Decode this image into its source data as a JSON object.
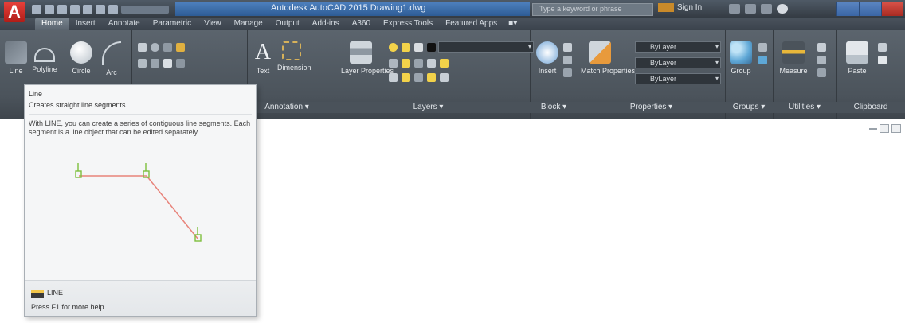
{
  "app": {
    "logo": "A",
    "title": "Autodesk AutoCAD 2015   Drawing1.dwg",
    "search_placeholder": "Type a keyword or phrase",
    "signin": "Sign In",
    "accent": "#e8413b"
  },
  "ribbon": {
    "tabs": [
      "Home",
      "Insert",
      "Annotate",
      "Parametric",
      "View",
      "Manage",
      "Output",
      "Add-ins",
      "A360",
      "Express Tools",
      "Featured Apps"
    ],
    "active_tab": "Home",
    "tab_extra": "■▾",
    "draw": {
      "line": "Line",
      "polyline": "Polyline",
      "circle": "Circle",
      "arc": "Arc"
    },
    "annotation": {
      "text": "Text",
      "dimension": "Dimension",
      "title": "Annotation ▾"
    },
    "layers": {
      "layer_properties": "Layer Properties",
      "title": "Layers ▾"
    },
    "block": {
      "insert": "Insert",
      "title": "Block ▾"
    },
    "properties": {
      "match_properties": "Match Properties",
      "combo1": "ByLayer",
      "combo2": "ByLayer",
      "combo3": "ByLayer",
      "title": "Properties ▾"
    },
    "groups": {
      "group": "Group",
      "title": "Groups ▾"
    },
    "utilities": {
      "measure": "Measure",
      "title": "Utilities ▾"
    },
    "clipboard": {
      "paste": "Paste",
      "title": "Clipboard"
    }
  },
  "tooltip": {
    "title": "Line",
    "description": "Creates straight line segments",
    "body": "With LINE, you can create a series of contiguous line segments. Each segment is a line object that can be edited separately.",
    "command_name": "LINE",
    "help_hint": "Press F1 for more help",
    "line_color": "#e8837a",
    "grip_color": "#7dbf3c"
  }
}
